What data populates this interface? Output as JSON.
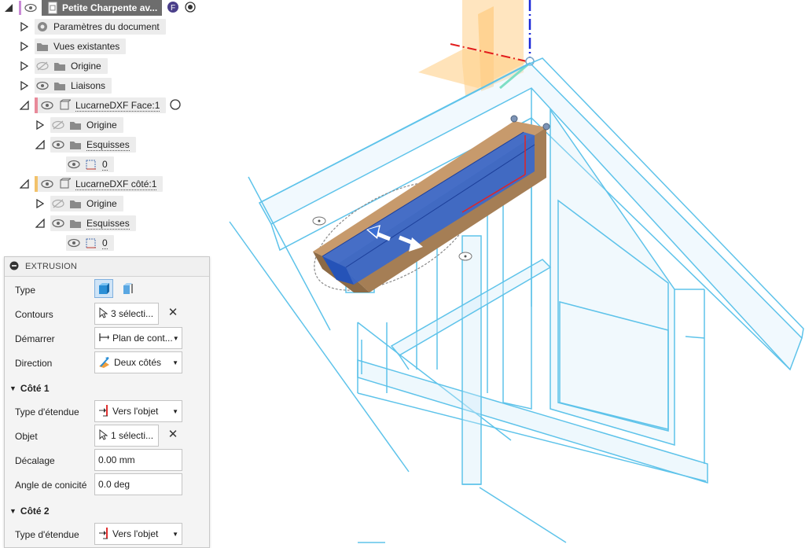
{
  "browser": {
    "root_title": "Petite Charpente av...",
    "items": [
      {
        "label": "Paramètres du document"
      },
      {
        "label": "Vues existantes"
      },
      {
        "label": "Origine"
      },
      {
        "label": "Liaisons"
      },
      {
        "label": "LucarneDXF Face:1"
      },
      {
        "label": "Origine"
      },
      {
        "label": "Esquisses"
      },
      {
        "label": "0"
      },
      {
        "label": "LucarneDXF côté:1"
      },
      {
        "label": "Origine"
      },
      {
        "label": "Esquisses"
      },
      {
        "label": "0"
      }
    ],
    "colors": {
      "face_marker": "#e88a9a",
      "cote_marker": "#f2c26b",
      "root_marker": "#c98ad6"
    }
  },
  "panel": {
    "title": "EXTRUSION",
    "rows": {
      "type": {
        "label": "Type"
      },
      "contours": {
        "label": "Contours",
        "value": "3 sélecti..."
      },
      "demarrer": {
        "label": "Démarrer",
        "value": "Plan de cont..."
      },
      "direction": {
        "label": "Direction",
        "value": "Deux côtés"
      },
      "cote1": {
        "section": "Côté 1"
      },
      "type_etendue1": {
        "label": "Type d'étendue",
        "value": "Vers l'objet"
      },
      "objet": {
        "label": "Objet",
        "value": "1 sélecti..."
      },
      "decalage": {
        "label": "Décalage",
        "value": "0.00 mm"
      },
      "angle": {
        "label": "Angle de conicité",
        "value": "0.0 deg"
      },
      "cote2": {
        "section": "Côté 2"
      },
      "type_etendue2": {
        "label": "Type d'étendue",
        "value": "Vers l'objet"
      }
    }
  },
  "viewport": {
    "icons": [
      "move-arrow-left-icon",
      "move-arrow-right-icon"
    ],
    "colors": {
      "wireframe": "#5ec3ea",
      "extrusion": "#2f66d6",
      "wood": "#a57e55",
      "plane": "#ffcc80"
    }
  }
}
